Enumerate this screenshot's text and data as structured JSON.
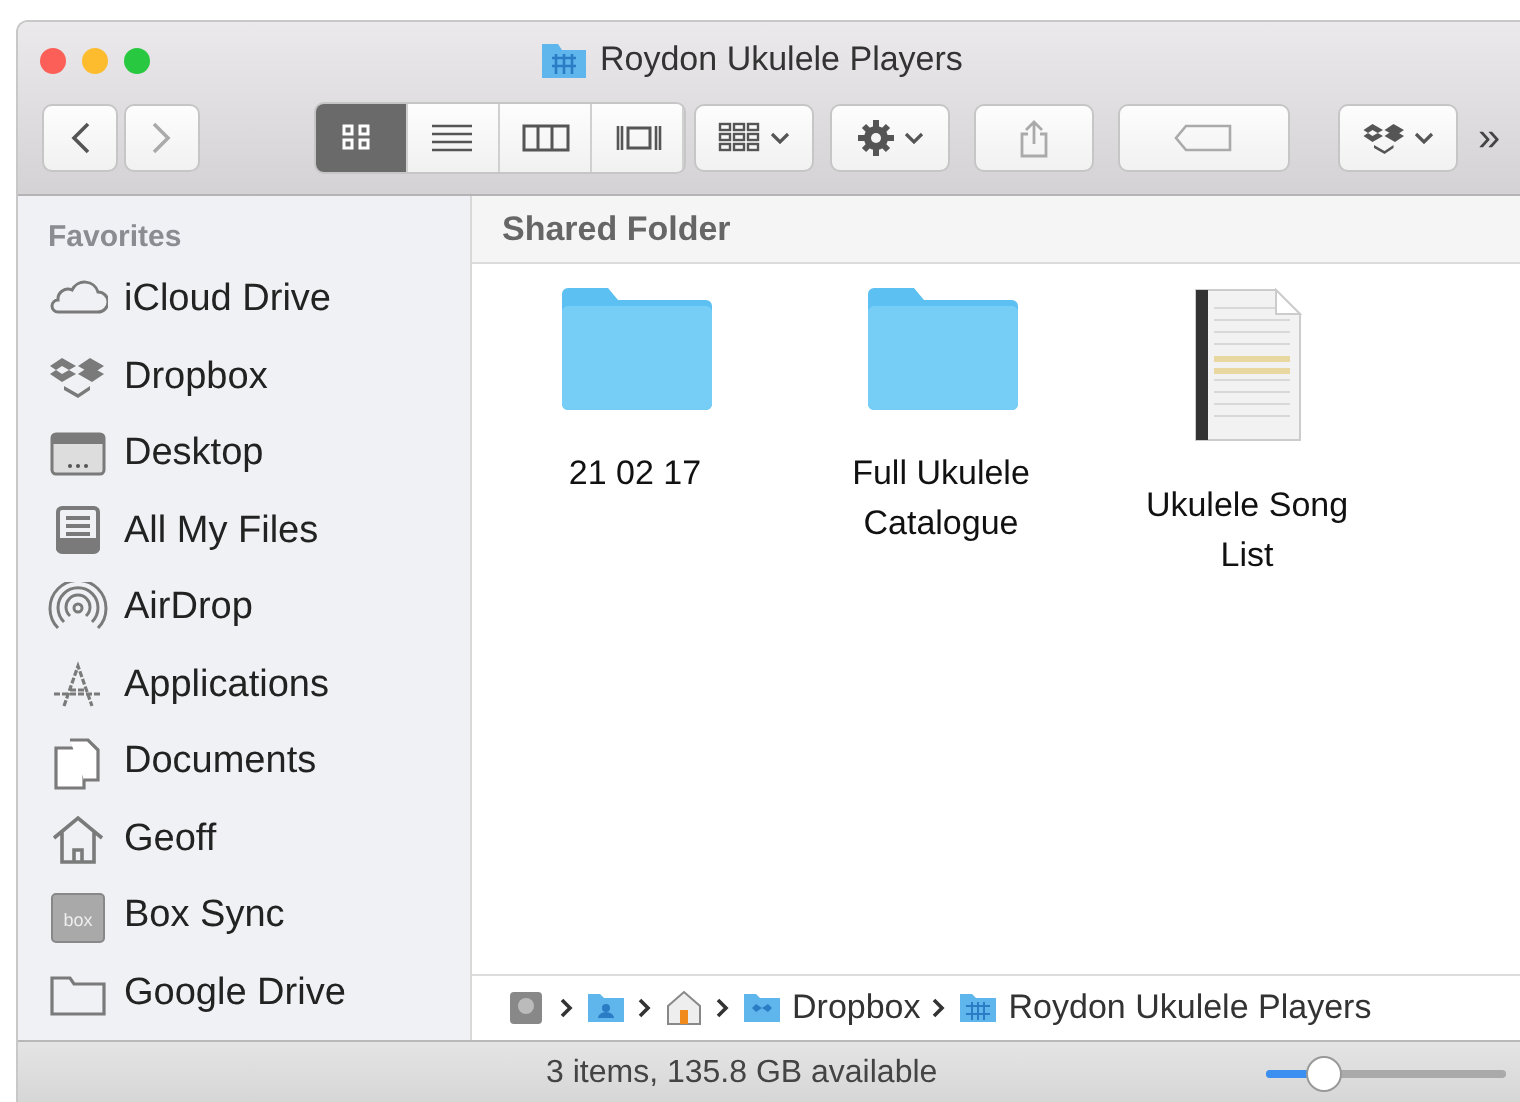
{
  "window": {
    "title": "Roydon Ukulele Players"
  },
  "toolbar": {
    "view_modes": [
      {
        "kind": "icons",
        "selected": true
      },
      {
        "kind": "list",
        "selected": false
      },
      {
        "kind": "columns",
        "selected": false
      },
      {
        "kind": "coverflow",
        "selected": false
      }
    ],
    "overflow": "»"
  },
  "sidebar": {
    "heading": "Favorites",
    "items": [
      {
        "kind": "cloud",
        "label": "iCloud Drive"
      },
      {
        "kind": "dropbox",
        "label": "Dropbox"
      },
      {
        "kind": "desktop",
        "label": "Desktop"
      },
      {
        "kind": "tray",
        "label": "All My Files"
      },
      {
        "kind": "airdrop",
        "label": "AirDrop"
      },
      {
        "kind": "apps",
        "label": "Applications"
      },
      {
        "kind": "docs",
        "label": "Documents"
      },
      {
        "kind": "home",
        "label": "Geoff"
      },
      {
        "kind": "box",
        "label": "Box Sync"
      },
      {
        "kind": "folder",
        "label": "Google Drive"
      }
    ]
  },
  "content": {
    "header": "Shared Folder",
    "files": [
      {
        "kind": "folder",
        "name": "21 02 17"
      },
      {
        "kind": "folder",
        "name": "Full Ukulele Catalogue"
      },
      {
        "kind": "document",
        "name": "Ukulele Song List"
      }
    ]
  },
  "path_bar": [
    {
      "kind": "disk"
    },
    {
      "kind": "user-folder"
    },
    {
      "kind": "home"
    },
    {
      "kind": "dropbox-folder",
      "label": "Dropbox"
    },
    {
      "kind": "shared-folder",
      "label": "Roydon Ukulele Players"
    }
  ],
  "status_bar": {
    "text": "3 items, 135.8 GB available",
    "zoom": {
      "level": 0.2
    }
  }
}
